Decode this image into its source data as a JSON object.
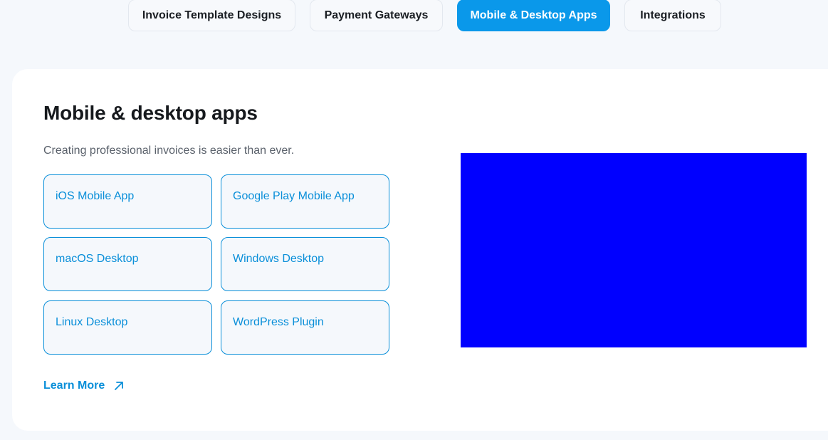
{
  "tabs": [
    {
      "label": "Invoice Template Designs",
      "active": false
    },
    {
      "label": "Payment Gateways",
      "active": false
    },
    {
      "label": "Mobile & Desktop Apps",
      "active": true
    },
    {
      "label": "Integrations",
      "active": false
    }
  ],
  "section": {
    "title": "Mobile & desktop apps",
    "subtitle": "Creating professional invoices is easier than ever.",
    "options": [
      "iOS Mobile App",
      "Google Play Mobile App",
      "macOS Desktop",
      "Windows Desktop",
      "Linux Desktop",
      "WordPress Plugin"
    ],
    "learn_more": "Learn More",
    "learn_more_icon": "arrow-up-right-icon"
  },
  "colors": {
    "accent": "#0a98ea",
    "placeholder": "#0000ff",
    "background": "#f5f8fc"
  }
}
